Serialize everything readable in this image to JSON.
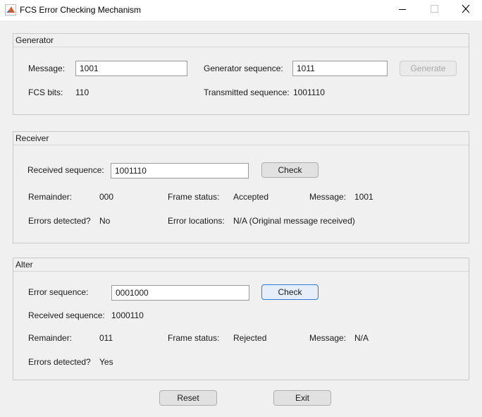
{
  "window": {
    "title": "FCS Error Checking Mechanism"
  },
  "generator": {
    "title": "Generator",
    "message_label": "Message:",
    "message_value": "1001",
    "gen_seq_label": "Generator sequence:",
    "gen_seq_value": "1011",
    "generate_button": "Generate",
    "fcs_label": "FCS bits:",
    "fcs_value": "110",
    "transmitted_label": "Transmitted sequence:",
    "transmitted_value": "1001110"
  },
  "receiver": {
    "title": "Receiver",
    "received_label": "Received sequence:",
    "received_value": "1001110",
    "check_button": "Check",
    "remainder_label": "Remainder:",
    "remainder_value": "000",
    "frame_status_label": "Frame status:",
    "frame_status_value": "Accepted",
    "message_label": "Message:",
    "message_value": "1001",
    "errors_label": "Errors detected?",
    "errors_value": "No",
    "locations_label": "Error locations:",
    "locations_value": "N/A (Original message received)"
  },
  "alter": {
    "title": "Alter",
    "error_seq_label": "Error sequence:",
    "error_seq_value": "0001000",
    "check_button": "Check",
    "received_label": "Received sequence:",
    "received_value": "1000110",
    "remainder_label": "Remainder:",
    "remainder_value": "011",
    "frame_status_label": "Frame status:",
    "frame_status_value": "Rejected",
    "message_label": "Message:",
    "message_value": "N/A",
    "errors_label": "Errors detected?",
    "errors_value": "Yes"
  },
  "footer": {
    "reset_button": "Reset",
    "exit_button": "Exit"
  },
  "icons": {
    "app": "matlab-logo-icon",
    "minimize": "minimize-icon",
    "maximize": "maximize-icon",
    "close": "close-icon"
  },
  "colors": {
    "focus_accent": "#2c7ad6",
    "background": "#f0f0f0"
  }
}
